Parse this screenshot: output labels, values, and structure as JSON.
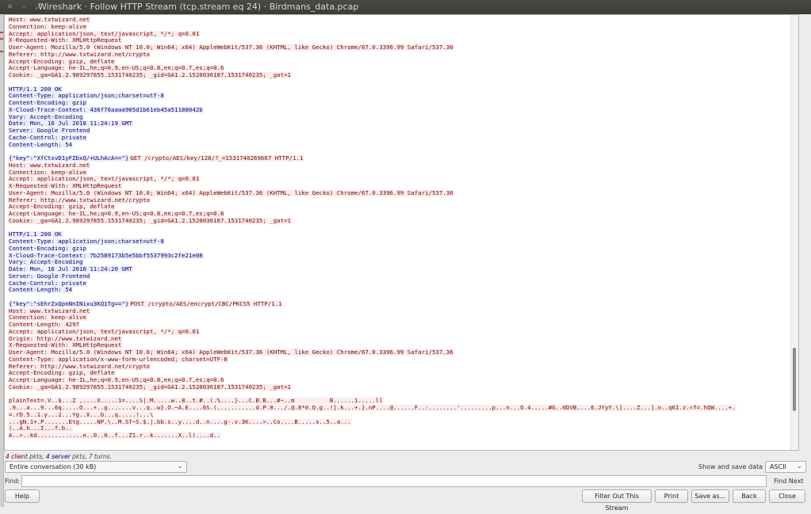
{
  "window": {
    "title": "Wireshark · Follow HTTP Stream (tcp.stream eq 24) · Birdmans_data.pcap",
    "controls": [
      "×",
      "–",
      "⤢"
    ]
  },
  "stream_lines": [
    {
      "d": "c",
      "t": "Host: www.txtwizard.net"
    },
    {
      "d": "c",
      "t": "Connection: keep-alive"
    },
    {
      "d": "c",
      "t": "Accept: application/json, text/javascript, */*; q=0.01"
    },
    {
      "d": "c",
      "t": "X-Requested-With: XMLHttpRequest"
    },
    {
      "d": "c",
      "t": "User-Agent: Mozilla/5.0 (Windows NT 10.0; Win64; x64) AppleWebKit/537.36 (KHTML, like Gecko) Chrome/67.0.3396.99 Safari/537.36"
    },
    {
      "d": "c",
      "t": "Referer: http://www.txtwizard.net/crypto"
    },
    {
      "d": "c",
      "t": "Accept-Encoding: gzip, deflate"
    },
    {
      "d": "c",
      "t": "Accept-Language: he-IL,he;q=0.9,en-US;q=0.8,en;q=0.7,es;q=0.6"
    },
    {
      "d": "c",
      "t": "Cookie: _ga=GA1.2.989297855.1531740235; _gid=GA1.2.1520036187.1531740235; _gat=1"
    },
    {
      "d": "g",
      "t": ""
    },
    {
      "d": "s",
      "t": "HTTP/1.1 200 OK"
    },
    {
      "d": "s",
      "t": "Content-Type: application/json;charset=utf-8"
    },
    {
      "d": "s",
      "t": "Content-Encoding: gzip"
    },
    {
      "d": "s",
      "t": "X-Cloud-Trace-Context: 436f76aaaa905d1b61eb45a51188042b"
    },
    {
      "d": "s",
      "t": "Vary: Accept-Encoding"
    },
    {
      "d": "s",
      "t": "Date: Mon, 16 Jul 2018 11:24:19 GMT"
    },
    {
      "d": "s",
      "t": "Server: Google Frontend"
    },
    {
      "d": "s",
      "t": "Cache-Control: private"
    },
    {
      "d": "s",
      "t": "Content-Length: 54"
    },
    {
      "d": "g",
      "t": ""
    },
    {
      "d": "m",
      "s": "{\"key\":\"XfCtxvD1yFZbxQ/+ULhAcA==\"}",
      "c": "GET /crypto/AES/key/128/?_=1531740269667 HTTP/1.1"
    },
    {
      "d": "c",
      "t": "Host: www.txtwizard.net"
    },
    {
      "d": "c",
      "t": "Connection: keep-alive"
    },
    {
      "d": "c",
      "t": "Accept: application/json, text/javascript, */*; q=0.01"
    },
    {
      "d": "c",
      "t": "X-Requested-With: XMLHttpRequest"
    },
    {
      "d": "c",
      "t": "User-Agent: Mozilla/5.0 (Windows NT 10.0; Win64; x64) AppleWebKit/537.36 (KHTML, like Gecko) Chrome/67.0.3396.99 Safari/537.36"
    },
    {
      "d": "c",
      "t": "Referer: http://www.txtwizard.net/crypto"
    },
    {
      "d": "c",
      "t": "Accept-Encoding: gzip, deflate"
    },
    {
      "d": "c",
      "t": "Accept-Language: he-IL,he;q=0.9,en-US;q=0.8,en;q=0.7,es;q=0.6"
    },
    {
      "d": "c",
      "t": "Cookie: _ga=GA1.2.989297855.1531740235; _gid=GA1.2.1520036187.1531740235; _gat=1"
    },
    {
      "d": "g",
      "t": ""
    },
    {
      "d": "s",
      "t": "HTTP/1.1 200 OK"
    },
    {
      "d": "s",
      "t": "Content-Type: application/json;charset=utf-8"
    },
    {
      "d": "s",
      "t": "Content-Encoding: gzip"
    },
    {
      "d": "s",
      "t": "X-Cloud-Trace-Context: 7b2589173b5e5bbf5537993c2fe21e08"
    },
    {
      "d": "s",
      "t": "Vary: Accept-Encoding"
    },
    {
      "d": "s",
      "t": "Date: Mon, 16 Jul 2018 11:24:20 GMT"
    },
    {
      "d": "s",
      "t": "Server: Google Frontend"
    },
    {
      "d": "s",
      "t": "Cache-Control: private"
    },
    {
      "d": "s",
      "t": "Content-Length: 54"
    },
    {
      "d": "g",
      "t": ""
    },
    {
      "d": "m",
      "s": "{\"key\":\"sEhrZxQpnNnINixu3KQ1Tg==\"}",
      "c": "POST /crypto/AES/encrypt/CBC/PKCS5 HTTP/1.1"
    },
    {
      "d": "c",
      "t": "Host: www.txtwizard.net"
    },
    {
      "d": "c",
      "t": "Connection: keep-alive"
    },
    {
      "d": "c",
      "t": "Content-Length: 4297"
    },
    {
      "d": "c",
      "t": "Accept: application/json, text/javascript, */*; q=0.01"
    },
    {
      "d": "c",
      "t": "Origin: http://www.txtwizard.net"
    },
    {
      "d": "c",
      "t": "X-Requested-With: XMLHttpRequest"
    },
    {
      "d": "c",
      "t": "User-Agent: Mozilla/5.0 (Windows NT 10.0; Win64; x64) AppleWebKit/537.36 (KHTML, like Gecko) Chrome/67.0.3396.99 Safari/537.36"
    },
    {
      "d": "c",
      "t": "Content-Type: application/x-www-form-urlencoded; charset=UTF-8"
    },
    {
      "d": "c",
      "t": "Referer: http://www.txtwizard.net/crypto"
    },
    {
      "d": "c",
      "t": "Accept-Encoding: gzip, deflate"
    },
    {
      "d": "c",
      "t": "Accept-Language: he-IL,he;q=0.9,en-US;q=0.8,en;q=0.7,es;q=0.6"
    },
    {
      "d": "c",
      "t": "Cookie: _ga=GA1.2.989297855.1531740235; _gid=GA1.2.1520036187.1531740235; _gat=1"
    },
    {
      "d": "g",
      "t": ""
    },
    {
      "d": "c",
      "t": "plainText=.V..$...Z ,....X.....1=....S|.M.....w..8..t.#..(.%....}...C.B.B...#~..m          B......1.....ll"
    },
    {
      "d": "c",
      "t": ".9...a...9...6q.....O...+..g.......v...q..w}.O.~A.E....6S.(...........d.P.0.../.@.8*0.Q.g..!].k...+.}.nP....@......F..:........'.........p...n...O.4.....#G..0DVB....6.JYyY.\\]....Z...].o..q6I.z.<f=.hQW....+."
    },
    {
      "d": "c",
      "t": "=.rD.5..1.y...2...Yg..X...b...q.....!...\\"
    },
    {
      "d": "c",
      "t": "...gN.1+.P.......Etg.....NP.\\..M.Sf~S.$.|.bb.s..y....d..n....g-.v.3K....>..Co....B.....s..5..a..."
    },
    {
      "d": "c",
      "t": "(..A.h...I...f.b.."
    },
    {
      "d": "c",
      "t": "A..>..kd.............e..0..0..f...Z1.r..k.......X..l)....d.."
    }
  ],
  "footer": {
    "stats_client": "4 client",
    "stats_client_suffix": " pkts, ",
    "stats_server": "4 server",
    "stats_server_suffix": " pkts, 7 turns.",
    "conversation_select": "Entire conversation (30 kB)",
    "show_save_label": "Show and save data as",
    "format_select": "ASCII",
    "find_label": "Find:",
    "find_value": "",
    "find_next": "Find Next",
    "help": "Help",
    "filter_out": "Filter Out This Stream",
    "print": "Print",
    "save_as": "Save as…",
    "back": "Back",
    "close": "Close"
  },
  "colors": {
    "client_text": "#7e0000",
    "client_bg": "#fbeded",
    "server_text": "#00007e",
    "server_bg": "#ededfb"
  }
}
